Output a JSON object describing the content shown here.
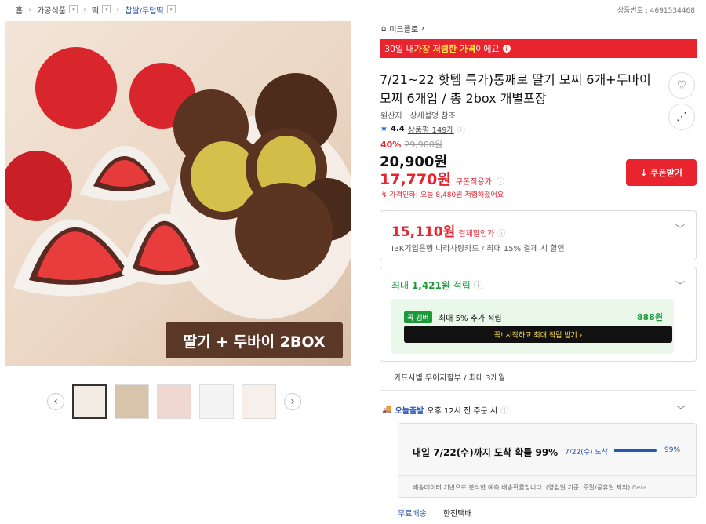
{
  "breadcrumb": [
    "홈",
    "가공식품",
    "떡",
    "찹쌀/두텁떡"
  ],
  "product_no": "상품번호 : 4691534468",
  "brand": "미크플로",
  "deal_banner": {
    "pre": "30일 내 ",
    "hl": "가장 저렴한 가격",
    "post": "이에요"
  },
  "title": "7/21~22 핫템 특가)통째로 딸기 모찌 6개+두바이 모찌 6개입 / 총 2box 개별포장",
  "origin": "원산지 : 상세설명 참조",
  "rating": {
    "score": "4.4",
    "reviews": "상품평 149개"
  },
  "price": {
    "discount_pct": "40%",
    "original": "29,900원",
    "sale": "20,900원",
    "coupon": "17,770원",
    "coupon_note": "쿠폰적용가",
    "drop_note": "가격인하! 오늘 8,480원 저렴해졌어요"
  },
  "coupon_button": "쿠폰받기",
  "payment": {
    "price": "15,110원",
    "label": "결제할인가",
    "desc": "IBK기업은행 나라사랑카드 / 최대 15% 결제 시 할인"
  },
  "points": {
    "pre": "최대 ",
    "amount": "1,421원",
    "post": " 적립",
    "member_badge": "꼭 멤버",
    "member_text": "최대 5% 추가 적립",
    "member_amount": "888원",
    "cta": "꼭! 시작하고 최대 적립 받기 ›"
  },
  "installment": "카드사별 무이자할부 / 최대 3개월",
  "shipping": {
    "tag": "오늘출발",
    "text": "오후 12시 전 주문 시"
  },
  "prediction": {
    "headline": "내일 7/22(수)까지 도착 확률 99%",
    "date_label": "7/22(수) 도착",
    "probability": 0.99,
    "pct": "99%",
    "note": "배송데이터 기반으로 분석한 예측 배송확률입니다. (영업일 기준, 주말/공휴일 제외)",
    "beta": "Beta"
  },
  "delivery": {
    "free": "무료배송",
    "carrier": "한진택배"
  },
  "hero_banner": "딸기 + 두바이 2BOX",
  "colors": {
    "accent": "#e8242f",
    "green": "#1b9a3a",
    "blue": "#2a55b5"
  }
}
